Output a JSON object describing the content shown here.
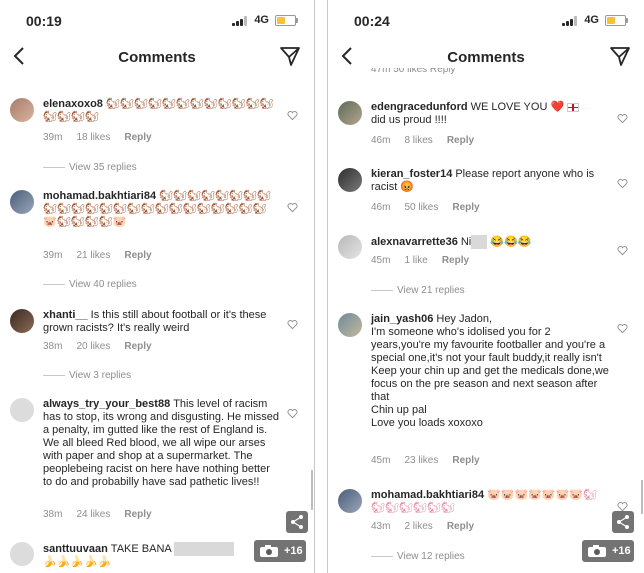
{
  "left": {
    "status": {
      "time": "00:19",
      "network": "4G"
    },
    "title": "Comments",
    "comments": [
      {
        "username": "elenaxoxo8",
        "text": "🐿🐿🐿🐿🐿🐿🐿🐿🐿🐿🐿🐿🐿🐿🐿🐿",
        "time": "39m",
        "likes": "18 likes",
        "reply": "Reply",
        "view_replies": "View 35 replies"
      },
      {
        "username": "mohamad.bakhtiari84",
        "text": "🐿🐿🐿🐿🐿🐿🐿🐿🐿🐿🐿🐿🐿🐿🐿🐿🐿🐿🐿🐿🐿🐿🐿🐿🐷🐿🐿🐿🐿🐷",
        "time": "39m",
        "likes": "21 likes",
        "reply": "Reply",
        "view_replies": "View 40 replies"
      },
      {
        "username": "xhanti__",
        "text": "Is this still about football or it's these grown racists? It's really weird",
        "time": "38m",
        "likes": "20 likes",
        "reply": "Reply",
        "view_replies": "View 3 replies"
      },
      {
        "username": "always_try_your_best88",
        "text": "This level of racism has to stop, its wrong and disgusting. He missed a penalty, im gutted like the rest of England is. We all bleed Red blood, we all wipe our arses with paper and shop at a supermarket. The peoplebeing racist on here have nothing better to do and probabilly have sad pathetic lives!!",
        "time": "38m",
        "likes": "24 likes",
        "reply": "Reply"
      },
      {
        "username": "santtuuvaan",
        "text": "TAKE BANA",
        "text_tail": "🍌🍌🍌🍌🍌"
      }
    ],
    "badge": "+16"
  },
  "right": {
    "status": {
      "time": "00:24",
      "network": "4G"
    },
    "title": "Comments",
    "partial_meta": "47m    50 likes    Reply",
    "comments": [
      {
        "username": "edengracedunford",
        "text": "WE LOVE YOU ❤️",
        "text_tail": "did us proud !!!!",
        "time": "46m",
        "likes": "8 likes",
        "reply": "Reply"
      },
      {
        "username": "kieran_foster14",
        "text": "Please report anyone who is racist 😡",
        "time": "46m",
        "likes": "50 likes",
        "reply": "Reply"
      },
      {
        "username": "alexnavarrette36",
        "text": "Ni",
        "text_tail": "😂😂😂",
        "time": "45m",
        "likes": "1 like",
        "reply": "Reply",
        "view_replies": "View 21 replies"
      },
      {
        "username": "jain_yash06",
        "text": "Hey Jadon,",
        "lines": [
          "I'm someone who's idolised you for 2 years,you're my favourite footballer and you're a special one,it's not your fault buddy,it really isn't",
          "Keep your chin up and get the medicals done,we focus on the pre season and next season after that",
          "Chin up pal",
          "Love you loads xoxoxo"
        ],
        "time": "45m",
        "likes": "23 likes",
        "reply": "Reply"
      },
      {
        "username": "mohamad.bakhtiari84",
        "text": "🐷🐷🐷🐷🐷🐷🐷🐿🐿🐿🐿🐿🐿🐿",
        "time": "43m",
        "likes": "2 likes",
        "reply": "Reply",
        "view_replies": "View 12 replies"
      }
    ],
    "badge": "+16"
  }
}
